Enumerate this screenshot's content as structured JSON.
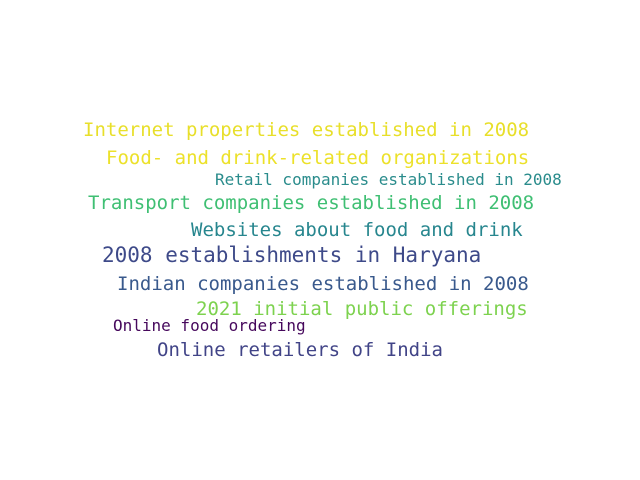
{
  "word_cloud": {
    "words": [
      {
        "text": "Internet properties established in 2008",
        "color": "#e8df2a"
      },
      {
        "text": "Food- and drink-related organizations",
        "color": "#ece12a"
      },
      {
        "text": "Retail companies established in 2008",
        "color": "#2a8c8c"
      },
      {
        "text": "Transport companies established in 2008",
        "color": "#3fbf73"
      },
      {
        "text": "Websites about food and drink",
        "color": "#27868e"
      },
      {
        "text": "2008 establishments in Haryana",
        "color": "#3e4a89"
      },
      {
        "text": "Indian companies established in 2008",
        "color": "#39598c"
      },
      {
        "text": "2021 initial public offerings",
        "color": "#7dd24f"
      },
      {
        "text": "Online food ordering",
        "color": "#46085c"
      },
      {
        "text": "Online retailers of India",
        "color": "#414487"
      }
    ]
  }
}
